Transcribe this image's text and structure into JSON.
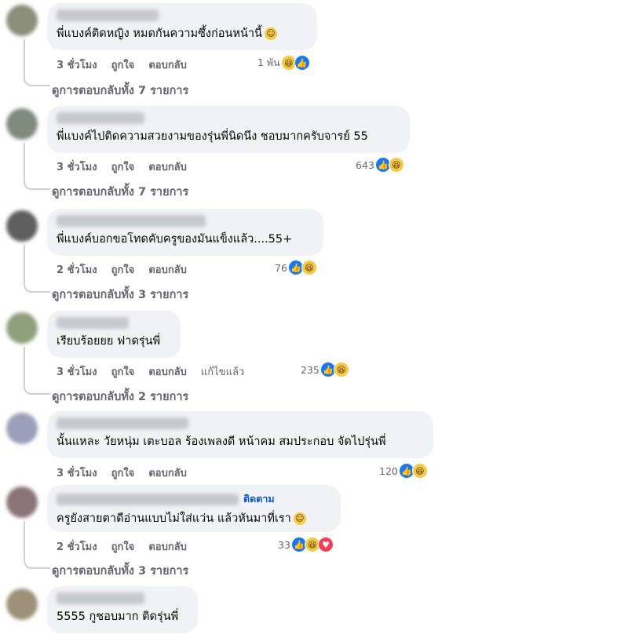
{
  "labels": {
    "like": "ถูกใจ",
    "reply": "ตอบกลับ",
    "edited": "แก้ไขแล้ว",
    "follow": "ติดตาม"
  },
  "colors": {
    "bubble": "#f0f2f5",
    "action": "#65676b",
    "like": "#1877f2",
    "haha": "#f7c948",
    "love": "#f33e58"
  },
  "comments": [
    {
      "text": "พี่แบงค์ติดหญิง หมดกันความซึ้งก่อนหน้านี้",
      "time": "3 ชั่วโมง",
      "reactions": "1 พัน",
      "replies": "ดูการตอบกลับทั้ง 7 รายการ",
      "avatar_color": "#8c8f7a"
    },
    {
      "text": "พี่แบงค์ไปติดความสวยงามของรุ่นพี่นิดนึง ชอบมากครับจารย์ 55",
      "time": "3 ชั่วโมง",
      "reactions": "643",
      "replies": "ดูการตอบกลับทั้ง 7 รายการ",
      "avatar_color": "#7f8a7d"
    },
    {
      "text": "พี่แบงค์บอกขอโทดคับครูของมันแข็งแล้ว....55+",
      "time": "2 ชั่วโมง",
      "reactions": "76",
      "replies": "ดูการตอบกลับทั้ง 3 รายการ",
      "avatar_color": "#5f5f5f"
    },
    {
      "text": "เรียบร้อยยย ฟาดรุ่นพี่",
      "time": "3 ชั่วโมง",
      "reactions": "235",
      "replies": "ดูการตอบกลับทั้ง 2 รายการ",
      "avatar_color": "#8fa07c"
    },
    {
      "text": "นั้นแหละ วัยหนุ่ม เตะบอล ร้องเพลงดี หน้าคม สมประกอบ จัดไปรุ่นพี่",
      "time": "3 ชั่วโมง",
      "reactions": "120",
      "replies": "",
      "avatar_color": "#9b9fb8"
    },
    {
      "text": "ครูยังสายตาดีอ่านแบบไม่ใส่แว่น แล้วหันมาที่เรา",
      "time": "2 ชั่วโมง",
      "reactions": "33",
      "replies": "ดูการตอบกลับทั้ง 3 รายการ",
      "avatar_color": "#8a7476"
    },
    {
      "text": "5555 กูชอบมาก ติดรุ่นพี่",
      "time": "",
      "reactions": "",
      "replies": "",
      "avatar_color": "#9c9179"
    }
  ]
}
